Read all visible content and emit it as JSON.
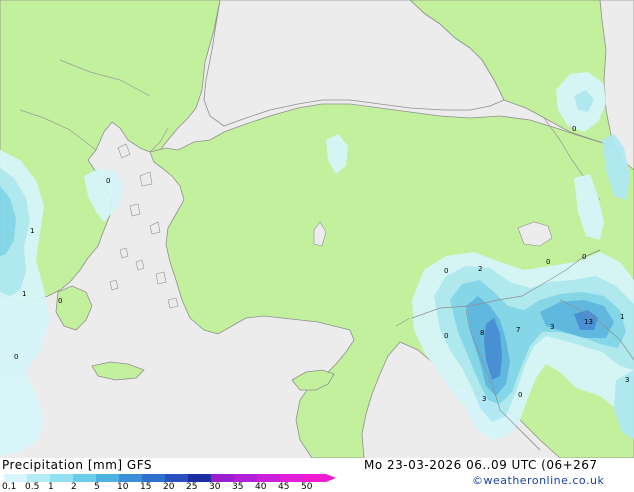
{
  "header": {
    "title": "Precipitation [mm]",
    "model": "GFS",
    "valid": "Mo 23-03-2026 06..09 UTC (06+267",
    "credit": "©weatheronline.co.uk"
  },
  "legend": {
    "ticks": [
      "0.1",
      "0.5",
      "1",
      "2",
      "5",
      "10",
      "15",
      "20",
      "25",
      "30",
      "35",
      "40",
      "45",
      "50"
    ],
    "colors": [
      "#d9f5fb",
      "#b4ecf6",
      "#8fe0f0",
      "#6ccdea",
      "#4cb3e0",
      "#3a8fd8",
      "#2e6fd0",
      "#2850bf",
      "#1c2ea0",
      "#9b1fd1",
      "#b31fd6",
      "#cc1fdb",
      "#e11fd8",
      "#f01ad0"
    ]
  },
  "map": {
    "colors": {
      "sea": "#ececec",
      "land": "#c3f09c",
      "border": "#8f8f8f",
      "precip_1": "#d6f6fb",
      "precip_2": "#aee9f5",
      "precip_3": "#80d4ee",
      "precip_4": "#58b4e4",
      "precip_5": "#3e88d8"
    },
    "values": [
      {
        "id": "v-aegean-n",
        "text": "0"
      },
      {
        "id": "v-west-1a",
        "text": "1"
      },
      {
        "id": "v-west-1b",
        "text": "1"
      },
      {
        "id": "v-west-0a",
        "text": "0"
      },
      {
        "id": "v-west-0b",
        "text": "0"
      },
      {
        "id": "v-caucasus-0",
        "text": "0"
      },
      {
        "id": "v-syria-0a",
        "text": "0"
      },
      {
        "id": "v-syria-2",
        "text": "2"
      },
      {
        "id": "v-iraq-0",
        "text": "0"
      },
      {
        "id": "v-iran-0",
        "text": "0"
      },
      {
        "id": "v-syria-8",
        "text": "8"
      },
      {
        "id": "v-syria-7",
        "text": "7"
      },
      {
        "id": "v-iraq-3",
        "text": "3"
      },
      {
        "id": "v-iraq-13",
        "text": "13"
      },
      {
        "id": "v-iran-1",
        "text": "1"
      },
      {
        "id": "v-leb-0",
        "text": "0"
      },
      {
        "id": "v-jordan-3",
        "text": "3"
      },
      {
        "id": "v-jordan-0",
        "text": "0"
      },
      {
        "id": "v-east-3",
        "text": "3"
      }
    ]
  }
}
